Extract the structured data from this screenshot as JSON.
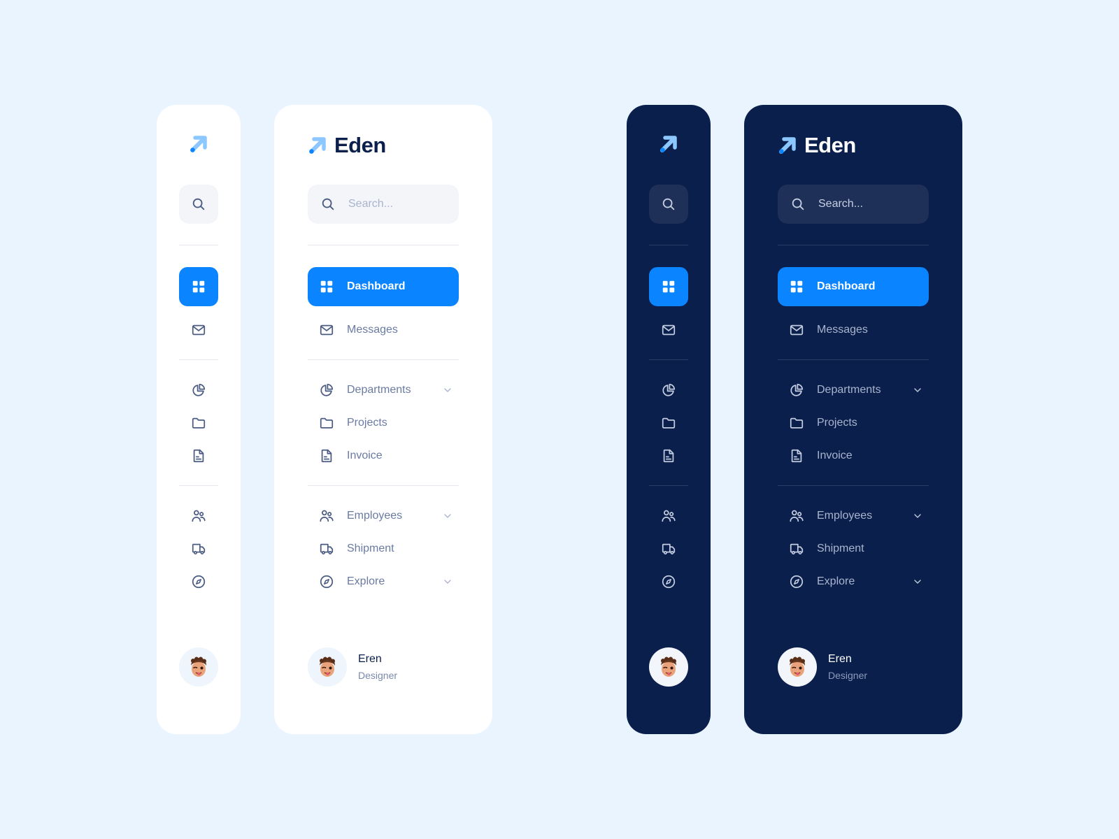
{
  "brand": {
    "name": "Eden",
    "logo_icon": "arrow-up-right-icon"
  },
  "search": {
    "placeholder": "Search...",
    "icon": "search-icon"
  },
  "nav": {
    "groups": [
      [
        {
          "id": "dashboard",
          "label": "Dashboard",
          "icon": "grid-icon",
          "active": true,
          "has_chevron": false
        },
        {
          "id": "messages",
          "label": "Messages",
          "icon": "mail-icon",
          "active": false,
          "has_chevron": false
        }
      ],
      [
        {
          "id": "departments",
          "label": "Departments",
          "icon": "pie-chart-icon",
          "active": false,
          "has_chevron": true
        },
        {
          "id": "projects",
          "label": "Projects",
          "icon": "folder-icon",
          "active": false,
          "has_chevron": false
        },
        {
          "id": "invoice",
          "label": "Invoice",
          "icon": "file-text-icon",
          "active": false,
          "has_chevron": false
        }
      ],
      [
        {
          "id": "employees",
          "label": "Employees",
          "icon": "users-icon",
          "active": false,
          "has_chevron": true
        },
        {
          "id": "shipment",
          "label": "Shipment",
          "icon": "truck-icon",
          "active": false,
          "has_chevron": false
        },
        {
          "id": "explore",
          "label": "Explore",
          "icon": "compass-icon",
          "active": false,
          "has_chevron": true
        }
      ]
    ]
  },
  "user": {
    "name": "Eren",
    "role": "Designer",
    "avatar": "memoji-avatar"
  },
  "themes": {
    "light": {
      "panel_bg": "#FFFFFF",
      "text": "#0A1F4B",
      "muted": "#6A7BA2"
    },
    "dark": {
      "panel_bg": "#0A1F4B",
      "text": "#FFFFFF",
      "muted": "#A9B5CF"
    },
    "accent": "#0A84FF",
    "page_bg": "#EAF4FF"
  }
}
